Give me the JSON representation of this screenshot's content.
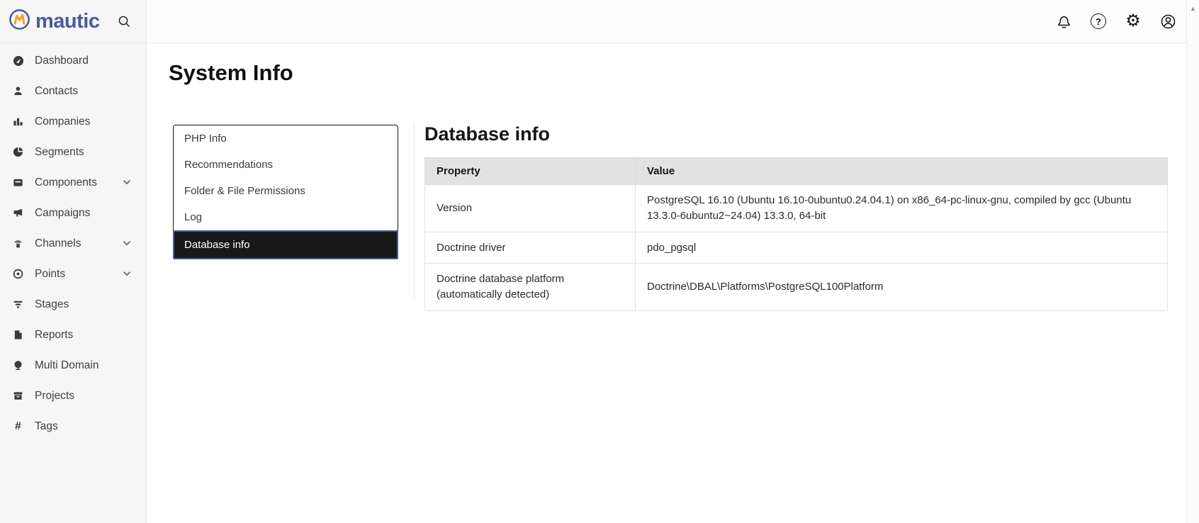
{
  "glyphs": {
    "gear": "⚙",
    "hash": "#",
    "scroll_up": "▲",
    "question": "?"
  },
  "colors": {
    "brand_blue": "#4a5a9c",
    "logo_yellow": "#f0a21f",
    "active_tab_bg": "#181818",
    "active_tab_border": "#4d5b96",
    "table_header_bg": "#e2e2e2",
    "sidebar_bg": "#f6f6f6"
  },
  "topbar": {
    "logo_text": "mautic"
  },
  "sidebar": {
    "items": [
      {
        "label": "Dashboard",
        "icon": "gauge-icon",
        "chevron": false
      },
      {
        "label": "Contacts",
        "icon": "person-icon",
        "chevron": false
      },
      {
        "label": "Companies",
        "icon": "building-icon",
        "chevron": false
      },
      {
        "label": "Segments",
        "icon": "pie-icon",
        "chevron": false
      },
      {
        "label": "Components",
        "icon": "box-icon",
        "chevron": true
      },
      {
        "label": "Campaigns",
        "icon": "megaphone-icon",
        "chevron": false
      },
      {
        "label": "Channels",
        "icon": "broadcast-icon",
        "chevron": true
      },
      {
        "label": "Points",
        "icon": "target-icon",
        "chevron": true
      },
      {
        "label": "Stages",
        "icon": "funnel-icon",
        "chevron": false
      },
      {
        "label": "Reports",
        "icon": "document-icon",
        "chevron": false
      },
      {
        "label": "Multi Domain",
        "icon": "globe-icon",
        "chevron": false
      },
      {
        "label": "Projects",
        "icon": "archive-icon",
        "chevron": false
      },
      {
        "label": "Tags",
        "icon": "hash-icon",
        "chevron": false
      }
    ]
  },
  "page": {
    "title": "System Info"
  },
  "tabs": {
    "items": [
      {
        "label": "PHP Info",
        "active": false
      },
      {
        "label": "Recommendations",
        "active": false
      },
      {
        "label": "Folder & File Permissions",
        "active": false
      },
      {
        "label": "Log",
        "active": false
      },
      {
        "label": "Database info",
        "active": true
      }
    ]
  },
  "panel": {
    "heading": "Database info",
    "table": {
      "columns": [
        "Property",
        "Value"
      ],
      "rows": [
        {
          "property": "Version",
          "value": "PostgreSQL 16.10 (Ubuntu 16.10-0ubuntu0.24.04.1) on x86_64-pc-linux-gnu, compiled by gcc (Ubuntu 13.3.0-6ubuntu2~24.04) 13.3.0, 64-bit"
        },
        {
          "property": "Doctrine driver",
          "value": "pdo_pgsql"
        },
        {
          "property": "Doctrine database platform (automatically detected)",
          "value": "Doctrine\\DBAL\\Platforms\\PostgreSQL100Platform"
        }
      ]
    }
  }
}
